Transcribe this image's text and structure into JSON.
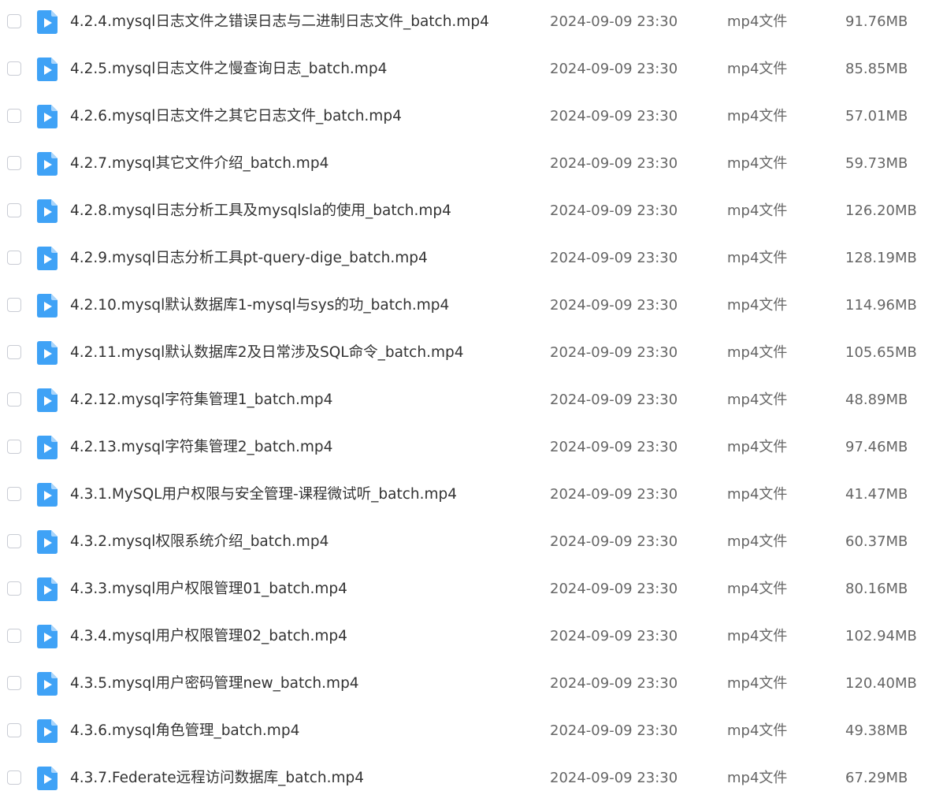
{
  "colors": {
    "icon_blue": "#3fa2f6",
    "icon_fold": "#a9d5fb",
    "text_primary": "#333333",
    "text_secondary": "#666666",
    "checkbox_border": "#c9ccd4"
  },
  "icons": {
    "file": "video-file-icon"
  },
  "files": [
    {
      "name": "4.2.4.mysql日志文件之错误日志与二进制日志文件_batch.mp4",
      "date": "2024-09-09 23:30",
      "type": "mp4文件",
      "size": "91.76MB"
    },
    {
      "name": "4.2.5.mysql日志文件之慢查询日志_batch.mp4",
      "date": "2024-09-09 23:30",
      "type": "mp4文件",
      "size": "85.85MB"
    },
    {
      "name": "4.2.6.mysql日志文件之其它日志文件_batch.mp4",
      "date": "2024-09-09 23:30",
      "type": "mp4文件",
      "size": "57.01MB"
    },
    {
      "name": "4.2.7.mysql其它文件介绍_batch.mp4",
      "date": "2024-09-09 23:30",
      "type": "mp4文件",
      "size": "59.73MB"
    },
    {
      "name": "4.2.8.mysql日志分析工具及mysqlsla的使用_batch.mp4",
      "date": "2024-09-09 23:30",
      "type": "mp4文件",
      "size": "126.20MB"
    },
    {
      "name": "4.2.9.mysql日志分析工具pt-query-dige_batch.mp4",
      "date": "2024-09-09 23:30",
      "type": "mp4文件",
      "size": "128.19MB"
    },
    {
      "name": "4.2.10.mysql默认数据库1-mysql与sys的功_batch.mp4",
      "date": "2024-09-09 23:30",
      "type": "mp4文件",
      "size": "114.96MB"
    },
    {
      "name": "4.2.11.mysql默认数据库2及日常涉及SQL命令_batch.mp4",
      "date": "2024-09-09 23:30",
      "type": "mp4文件",
      "size": "105.65MB"
    },
    {
      "name": "4.2.12.mysql字符集管理1_batch.mp4",
      "date": "2024-09-09 23:30",
      "type": "mp4文件",
      "size": "48.89MB"
    },
    {
      "name": "4.2.13.mysql字符集管理2_batch.mp4",
      "date": "2024-09-09 23:30",
      "type": "mp4文件",
      "size": "97.46MB"
    },
    {
      "name": "4.3.1.MySQL用户权限与安全管理-课程微试听_batch.mp4",
      "date": "2024-09-09 23:30",
      "type": "mp4文件",
      "size": "41.47MB"
    },
    {
      "name": "4.3.2.mysql权限系统介绍_batch.mp4",
      "date": "2024-09-09 23:30",
      "type": "mp4文件",
      "size": "60.37MB"
    },
    {
      "name": "4.3.3.mysql用户权限管理01_batch.mp4",
      "date": "2024-09-09 23:30",
      "type": "mp4文件",
      "size": "80.16MB"
    },
    {
      "name": "4.3.4.mysql用户权限管理02_batch.mp4",
      "date": "2024-09-09 23:30",
      "type": "mp4文件",
      "size": "102.94MB"
    },
    {
      "name": "4.3.5.mysql用户密码管理new_batch.mp4",
      "date": "2024-09-09 23:30",
      "type": "mp4文件",
      "size": "120.40MB"
    },
    {
      "name": "4.3.6.mysql角色管理_batch.mp4",
      "date": "2024-09-09 23:30",
      "type": "mp4文件",
      "size": "49.38MB"
    },
    {
      "name": "4.3.7.Federate远程访问数据库_batch.mp4",
      "date": "2024-09-09 23:30",
      "type": "mp4文件",
      "size": "67.29MB"
    }
  ]
}
